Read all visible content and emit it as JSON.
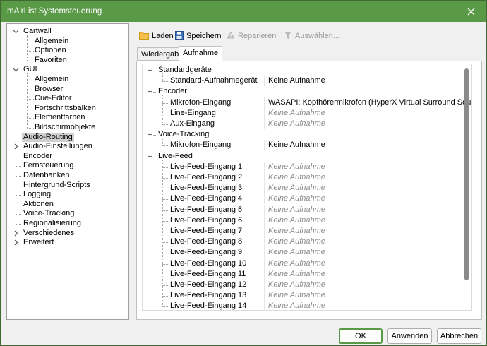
{
  "window": {
    "title": "mAirList Systemsteuerung"
  },
  "icons": {
    "close": "close-icon",
    "open": "folder-icon",
    "save": "floppy-disk-icon",
    "repair": "warning-icon",
    "select": "filter-icon"
  },
  "colors": {
    "titlebar": "#5a9a47",
    "accent": "#5a9a47"
  },
  "tree": {
    "items": [
      {
        "label": "Cartwall",
        "level": 0,
        "expanded": true
      },
      {
        "label": "Allgemein",
        "level": 1
      },
      {
        "label": "Optionen",
        "level": 1
      },
      {
        "label": "Favoriten",
        "level": 1
      },
      {
        "label": "GUI",
        "level": 0,
        "expanded": true
      },
      {
        "label": "Allgemein",
        "level": 1
      },
      {
        "label": "Browser",
        "level": 1
      },
      {
        "label": "Cue-Editor",
        "level": 1
      },
      {
        "label": "Fortschrittsbalken",
        "level": 1
      },
      {
        "label": "Elementfarben",
        "level": 1
      },
      {
        "label": "Bildschirmobjekte",
        "level": 1
      },
      {
        "label": "Audio-Routing",
        "level": 0,
        "selected": true
      },
      {
        "label": "Audio-Einstellungen",
        "level": 0,
        "collapsed": true
      },
      {
        "label": "Encoder",
        "level": 0
      },
      {
        "label": "Fernsteuerung",
        "level": 0
      },
      {
        "label": "Datenbanken",
        "level": 0
      },
      {
        "label": "Hintergrund-Scripts",
        "level": 0
      },
      {
        "label": "Logging",
        "level": 0
      },
      {
        "label": "Aktionen",
        "level": 0
      },
      {
        "label": "Voice-Tracking",
        "level": 0
      },
      {
        "label": "Regionalisierung",
        "level": 0
      },
      {
        "label": "Verschiedenes",
        "level": 0,
        "collapsed": true
      },
      {
        "label": "Erweitert",
        "level": 0,
        "collapsed": true
      }
    ]
  },
  "toolbar": {
    "open_label": "Laden",
    "save_label": "Speichern",
    "repair_label": "Reparieren",
    "select_label": "Auswählen..."
  },
  "tabs": [
    {
      "label": "Wiedergabe",
      "active": false
    },
    {
      "label": "Aufnahme",
      "active": true
    }
  ],
  "properties": {
    "rows": [
      {
        "type": "group",
        "label": "Standardgeräte"
      },
      {
        "type": "item",
        "label": "Standard-Aufnahmegerät",
        "value": "Keine Aufnahme",
        "empty": false
      },
      {
        "type": "group",
        "label": "Encoder"
      },
      {
        "type": "item",
        "label": "Mikrofon-Eingang",
        "value": "WASAPI: Kopfhörermikrofon (HyperX Virtual Surround Sound)",
        "empty": false
      },
      {
        "type": "item",
        "label": "Line-Eingang",
        "value": "Keine Aufnahme",
        "empty": true
      },
      {
        "type": "item",
        "label": "Aux-Eingang",
        "value": "Keine Aufnahme",
        "empty": true
      },
      {
        "type": "group",
        "label": "Voice-Tracking"
      },
      {
        "type": "item",
        "label": "Mikrofon-Eingang",
        "value": "Keine Aufnahme",
        "empty": false
      },
      {
        "type": "group",
        "label": "Live-Feed"
      },
      {
        "type": "item",
        "label": "Live-Feed-Eingang 1",
        "value": "Keine Aufnahme",
        "empty": true
      },
      {
        "type": "item",
        "label": "Live-Feed-Eingang 2",
        "value": "Keine Aufnahme",
        "empty": true
      },
      {
        "type": "item",
        "label": "Live-Feed-Eingang 3",
        "value": "Keine Aufnahme",
        "empty": true
      },
      {
        "type": "item",
        "label": "Live-Feed-Eingang 4",
        "value": "Keine Aufnahme",
        "empty": true
      },
      {
        "type": "item",
        "label": "Live-Feed-Eingang 5",
        "value": "Keine Aufnahme",
        "empty": true
      },
      {
        "type": "item",
        "label": "Live-Feed-Eingang 6",
        "value": "Keine Aufnahme",
        "empty": true
      },
      {
        "type": "item",
        "label": "Live-Feed-Eingang 7",
        "value": "Keine Aufnahme",
        "empty": true
      },
      {
        "type": "item",
        "label": "Live-Feed-Eingang 8",
        "value": "Keine Aufnahme",
        "empty": true
      },
      {
        "type": "item",
        "label": "Live-Feed-Eingang 9",
        "value": "Keine Aufnahme",
        "empty": true
      },
      {
        "type": "item",
        "label": "Live-Feed-Eingang 10",
        "value": "Keine Aufnahme",
        "empty": true
      },
      {
        "type": "item",
        "label": "Live-Feed-Eingang 11",
        "value": "Keine Aufnahme",
        "empty": true
      },
      {
        "type": "item",
        "label": "Live-Feed-Eingang 12",
        "value": "Keine Aufnahme",
        "empty": true
      },
      {
        "type": "item",
        "label": "Live-Feed-Eingang 13",
        "value": "Keine Aufnahme",
        "empty": true
      },
      {
        "type": "item",
        "label": "Live-Feed-Eingang 14",
        "value": "Keine Aufnahme",
        "empty": true
      }
    ]
  },
  "buttons": {
    "ok_label": "OK",
    "apply_label": "Anwenden",
    "cancel_label": "Abbrechen"
  }
}
